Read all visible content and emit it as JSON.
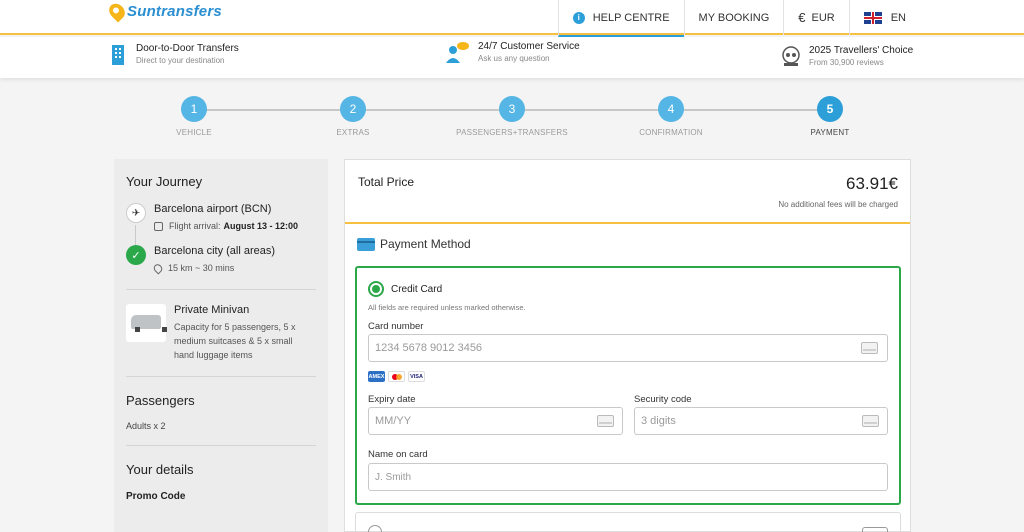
{
  "header": {
    "logo_text": "Suntransfers",
    "nav": {
      "help": "HELP CENTRE",
      "booking": "MY BOOKING",
      "currency_symbol": "€",
      "currency": "EUR",
      "language": "EN"
    }
  },
  "features": [
    {
      "title": "Door-to-Door Transfers",
      "sub": "Direct to your destination",
      "icon": "building-icon"
    },
    {
      "title": "24/7 Customer Service",
      "sub": "Ask us any question",
      "icon": "support-agent-icon"
    },
    {
      "title": "2025 Travellers' Choice",
      "sub": "From 30,900 reviews",
      "icon": "award-badge-icon"
    }
  ],
  "steps": [
    {
      "num": "1",
      "label": "VEHICLE"
    },
    {
      "num": "2",
      "label": "EXTRAS"
    },
    {
      "num": "3",
      "label": "PASSENGERS+TRANSFERS"
    },
    {
      "num": "4",
      "label": "CONFIRMATION"
    },
    {
      "num": "5",
      "label": "PAYMENT"
    }
  ],
  "active_step": 5,
  "sidebar": {
    "journey_title": "Your Journey",
    "from": "Barcelona airport (BCN)",
    "flight_label": "Flight arrival:",
    "flight_value": "August 13 - 12:00",
    "to": "Barcelona city (all areas)",
    "distance": "15 km ~ 30 mins",
    "vehicle_name": "Private Minivan",
    "vehicle_desc": "Capacity for 5 passengers, 5 x medium suitcases & 5 x small hand luggage items",
    "passengers_title": "Passengers",
    "passengers_value": "Adults x 2",
    "details_title": "Your details",
    "promo_label": "Promo Code"
  },
  "main": {
    "total_label": "Total Price",
    "total_amount": "63.91€",
    "total_note": "No additional fees will be charged",
    "payment_title": "Payment Method",
    "cc_label": "Credit Card",
    "cc_note": "All fields are required unless marked otherwise.",
    "card_number_label": "Card number",
    "card_number_placeholder": "1234 5678 9012 3456",
    "card_logos": [
      "AMEX",
      "MC",
      "VISA"
    ],
    "expiry_label": "Expiry date",
    "expiry_placeholder": "MM/YY",
    "security_label": "Security code",
    "security_placeholder": "3 digits",
    "name_label": "Name on card",
    "name_placeholder": "J. Smith"
  },
  "colors": {
    "brand_blue": "#2c9fd8",
    "accent_yellow": "#f6c141",
    "success_green": "#2ba84a"
  }
}
